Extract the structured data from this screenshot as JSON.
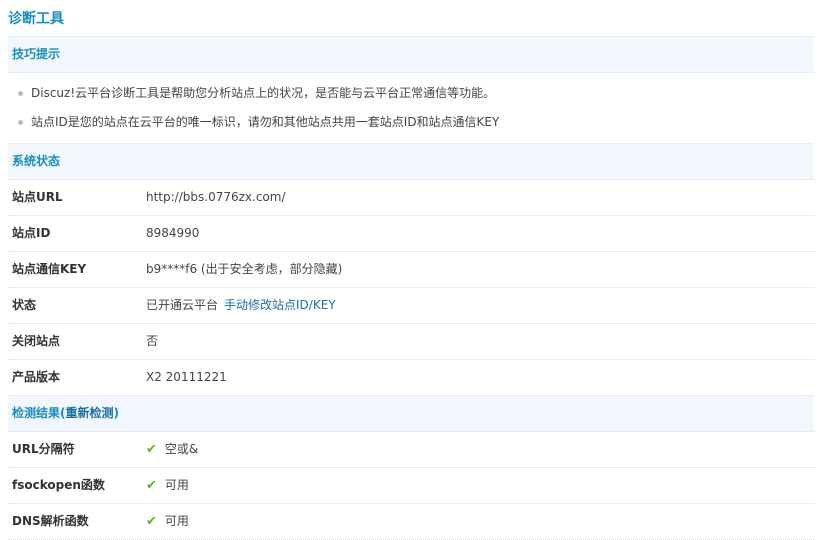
{
  "title": "诊断工具",
  "tips": {
    "header": "技巧提示",
    "items": [
      "Discuz!云平台诊断工具是帮助您分析站点上的状况，是否能与云平台正常通信等功能。",
      "站点ID是您的站点在云平台的唯一标识，请勿和其他站点共用一套站点ID和站点通信KEY"
    ]
  },
  "status": {
    "header": "系统状态",
    "rows": [
      {
        "label": "站点URL",
        "value": "http://bbs.0776zx.com/"
      },
      {
        "label": "站点ID",
        "value": "8984990"
      },
      {
        "label": "站点通信KEY",
        "value": "b9****f6 (出于安全考虑，部分隐藏)"
      },
      {
        "label": "状态",
        "value": "已开通云平台",
        "link": "手动修改站点ID/KEY"
      },
      {
        "label": "关闭站点",
        "value": "否"
      },
      {
        "label": "产品版本",
        "value": "X2 20111221"
      }
    ]
  },
  "results": {
    "header_prefix": "检测结果(",
    "recheck": "重新检测",
    "header_suffix": ")",
    "rows": [
      {
        "label": "URL分隔符",
        "value": "空或&"
      },
      {
        "label": "fsockopen函数",
        "value": "可用"
      },
      {
        "label": "DNS解析函数",
        "value": "可用"
      }
    ]
  }
}
